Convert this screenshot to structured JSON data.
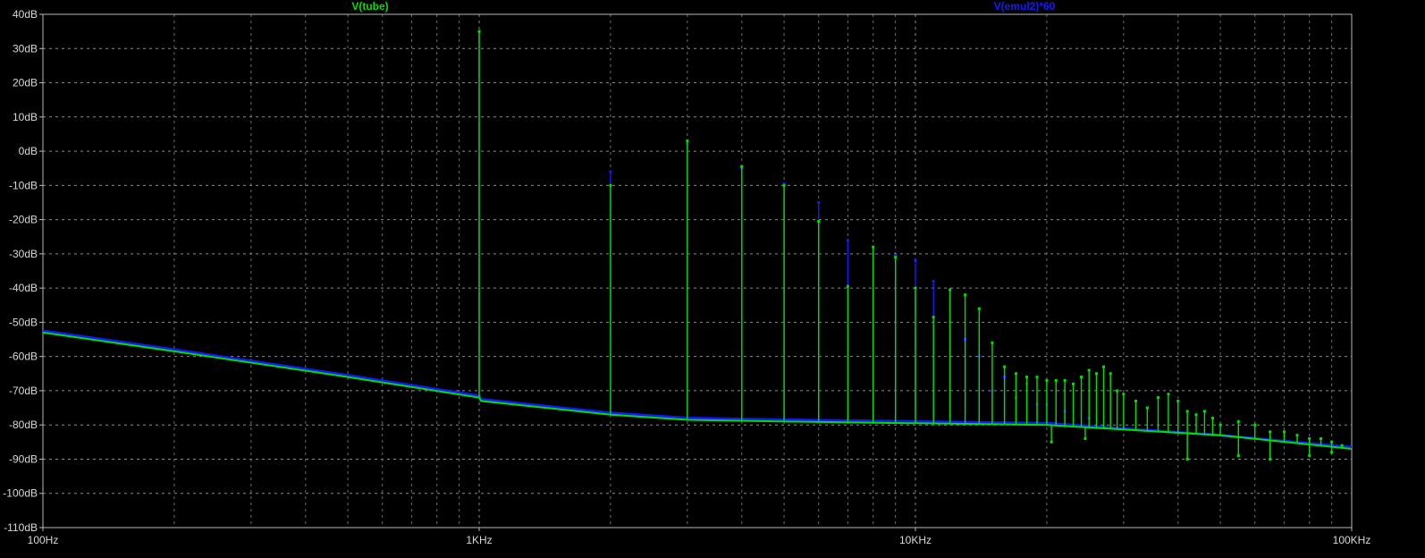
{
  "chart_data": {
    "type": "line",
    "x_scale": "log",
    "xlim": [
      100,
      100000
    ],
    "ylim": [
      -110,
      40
    ],
    "grid": true,
    "x_ticks": [
      {
        "value": 100,
        "label": "100Hz"
      },
      {
        "value": 1000,
        "label": "1KHz"
      },
      {
        "value": 10000,
        "label": "10KHz"
      },
      {
        "value": 100000,
        "label": "100KHz"
      }
    ],
    "y_ticks": [
      {
        "value": 40,
        "label": "40dB"
      },
      {
        "value": 30,
        "label": "30dB"
      },
      {
        "value": 20,
        "label": "20dB"
      },
      {
        "value": 10,
        "label": "10dB"
      },
      {
        "value": 0,
        "label": "0dB"
      },
      {
        "value": -10,
        "label": "-10dB"
      },
      {
        "value": -20,
        "label": "-20dB"
      },
      {
        "value": -30,
        "label": "-30dB"
      },
      {
        "value": -40,
        "label": "-40dB"
      },
      {
        "value": -50,
        "label": "-50dB"
      },
      {
        "value": -60,
        "label": "-60dB"
      },
      {
        "value": -70,
        "label": "-70dB"
      },
      {
        "value": -80,
        "label": "-80dB"
      },
      {
        "value": -90,
        "label": "-90dB"
      },
      {
        "value": -100,
        "label": "-100dB"
      },
      {
        "value": -110,
        "label": "-110dB"
      }
    ],
    "series": [
      {
        "name": "V(tube)",
        "color": "#00e000",
        "floor": [
          [
            100,
            -53
          ],
          [
            200,
            -58.5
          ],
          [
            500,
            -66
          ],
          [
            1000,
            -72
          ],
          [
            1010,
            -73
          ],
          [
            2000,
            -77
          ],
          [
            3000,
            -78.5
          ],
          [
            5000,
            -79
          ],
          [
            10000,
            -79.5
          ],
          [
            20000,
            -80
          ],
          [
            50000,
            -83
          ],
          [
            100000,
            -87
          ]
        ],
        "peaks": [
          [
            1000,
            35
          ],
          [
            2000,
            -10
          ],
          [
            3000,
            3
          ],
          [
            4000,
            -4.5
          ],
          [
            5000,
            -10
          ],
          [
            6000,
            -20.5
          ],
          [
            7000,
            -39.5
          ],
          [
            8000,
            -28
          ],
          [
            9000,
            -31
          ],
          [
            10000,
            -40
          ],
          [
            11000,
            -48.5
          ],
          [
            12000,
            -40.5
          ],
          [
            13000,
            -42
          ],
          [
            14000,
            -46
          ],
          [
            15000,
            -56
          ],
          [
            16000,
            -63
          ],
          [
            17000,
            -65
          ],
          [
            18000,
            -66
          ],
          [
            19000,
            -66
          ],
          [
            20000,
            -67
          ],
          [
            21000,
            -67
          ],
          [
            22000,
            -67
          ],
          [
            23000,
            -68
          ],
          [
            24000,
            -66
          ],
          [
            25000,
            -64
          ],
          [
            26000,
            -65
          ],
          [
            27000,
            -63
          ],
          [
            28000,
            -65
          ],
          [
            29000,
            -70
          ],
          [
            30000,
            -71
          ],
          [
            32000,
            -73
          ],
          [
            34000,
            -75
          ],
          [
            36000,
            -72
          ],
          [
            38000,
            -71
          ],
          [
            40000,
            -73
          ],
          [
            42000,
            -76
          ],
          [
            44000,
            -77
          ],
          [
            46000,
            -76
          ],
          [
            48000,
            -78
          ],
          [
            50000,
            -80
          ],
          [
            55000,
            -79
          ],
          [
            60000,
            -80
          ],
          [
            65000,
            -82
          ],
          [
            70000,
            -82
          ],
          [
            75000,
            -83
          ],
          [
            80000,
            -84
          ],
          [
            85000,
            -84
          ],
          [
            90000,
            -85
          ],
          [
            95000,
            -86
          ]
        ],
        "dips": [
          [
            20500,
            -85
          ],
          [
            24500,
            -84
          ],
          [
            42000,
            -90
          ],
          [
            55000,
            -89
          ],
          [
            65000,
            -90
          ],
          [
            80000,
            -89
          ],
          [
            90000,
            -88
          ]
        ]
      },
      {
        "name": "V(emul2)*60",
        "color": "#1818ff",
        "floor": [
          [
            100,
            -52.5
          ],
          [
            200,
            -58
          ],
          [
            500,
            -65.5
          ],
          [
            1000,
            -71.5
          ],
          [
            1010,
            -72.5
          ],
          [
            2000,
            -76.5
          ],
          [
            3000,
            -78
          ],
          [
            5000,
            -78.5
          ],
          [
            10000,
            -79
          ],
          [
            20000,
            -79.5
          ],
          [
            50000,
            -83
          ],
          [
            100000,
            -86.5
          ]
        ],
        "peaks": [
          [
            1000,
            35
          ],
          [
            2000,
            -6
          ],
          [
            3000,
            2
          ],
          [
            4000,
            -5
          ],
          [
            5000,
            -9.5
          ],
          [
            6000,
            -15
          ],
          [
            7000,
            -26
          ],
          [
            8000,
            -30
          ],
          [
            9000,
            -30.5
          ],
          [
            10000,
            -32
          ],
          [
            11000,
            -38
          ],
          [
            12000,
            -50
          ],
          [
            13000,
            -55
          ],
          [
            14000,
            -60
          ],
          [
            15000,
            -70
          ],
          [
            16000,
            -66
          ],
          [
            17000,
            -72
          ],
          [
            18000,
            -68
          ],
          [
            19000,
            -74
          ],
          [
            20000,
            -74
          ],
          [
            22000,
            -76
          ],
          [
            25000,
            -78
          ]
        ],
        "dips": []
      }
    ]
  }
}
